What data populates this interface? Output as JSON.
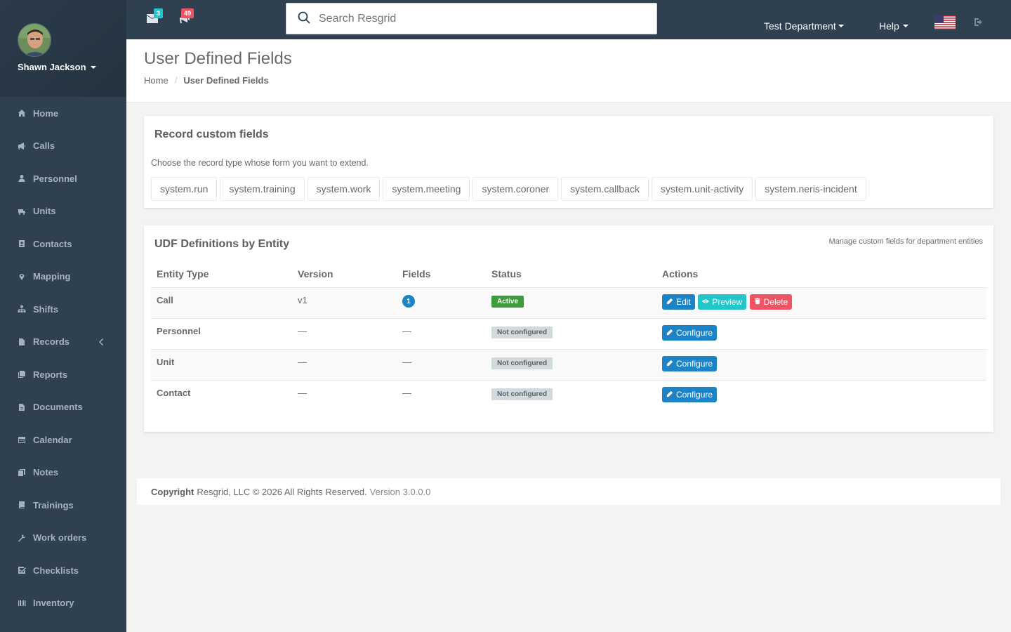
{
  "user": {
    "name": "Shawn Jackson"
  },
  "sidebar": {
    "items": [
      {
        "label": "Home",
        "icon": "home-icon"
      },
      {
        "label": "Calls",
        "icon": "bullhorn-icon"
      },
      {
        "label": "Personnel",
        "icon": "user-icon"
      },
      {
        "label": "Units",
        "icon": "truck-icon"
      },
      {
        "label": "Contacts",
        "icon": "address-book-icon"
      },
      {
        "label": "Mapping",
        "icon": "map-marker-icon"
      },
      {
        "label": "Shifts",
        "icon": "sitemap-icon"
      },
      {
        "label": "Records",
        "icon": "file-icon",
        "has_arrow": true
      },
      {
        "label": "Reports",
        "icon": "reports-icon"
      },
      {
        "label": "Documents",
        "icon": "documents-icon"
      },
      {
        "label": "Calendar",
        "icon": "calendar-icon"
      },
      {
        "label": "Notes",
        "icon": "notes-icon"
      },
      {
        "label": "Trainings",
        "icon": "book-icon"
      },
      {
        "label": "Work orders",
        "icon": "wrench-icon"
      },
      {
        "label": "Checklists",
        "icon": "check-square-icon"
      },
      {
        "label": "Inventory",
        "icon": "barcode-icon"
      }
    ]
  },
  "topbar": {
    "messages_count": "3",
    "calls_count": "49",
    "search_placeholder": "Search Resgrid",
    "department": "Test Department",
    "help": "Help"
  },
  "header": {
    "title": "User Defined Fields",
    "breadcrumb_home": "Home",
    "breadcrumb_current": "User Defined Fields"
  },
  "record_panel": {
    "title": "Record custom fields",
    "help": "Choose the record type whose form you want to extend.",
    "types": [
      "system.run",
      "system.training",
      "system.work",
      "system.meeting",
      "system.coroner",
      "system.callback",
      "system.unit-activity",
      "system.neris-incident"
    ]
  },
  "udf_panel": {
    "title": "UDF Definitions by Entity",
    "subtitle": "Manage custom fields for department entities",
    "columns": [
      "Entity Type",
      "Version",
      "Fields",
      "Status",
      "Actions"
    ],
    "rows": [
      {
        "entity": "Call",
        "version": "v1",
        "fields": "1",
        "status": "Active",
        "actions": [
          "Edit",
          "Preview",
          "Delete"
        ]
      },
      {
        "entity": "Personnel",
        "version": "—",
        "fields": "—",
        "status": "Not configured",
        "actions": [
          "Configure"
        ]
      },
      {
        "entity": "Unit",
        "version": "—",
        "fields": "—",
        "status": "Not configured",
        "actions": [
          "Configure"
        ]
      },
      {
        "entity": "Contact",
        "version": "—",
        "fields": "—",
        "status": "Not configured",
        "actions": [
          "Configure"
        ]
      }
    ]
  },
  "footer": {
    "copyright_label": "Copyright",
    "text": "Resgrid, LLC © 2026 All Rights Reserved.",
    "version": "Version 3.0.0.0"
  },
  "colors": {
    "sidebar_bg": "#2f4050",
    "primary": "#1c84c6",
    "info": "#23c6c8",
    "danger": "#ed5565",
    "active_label": "#3c9c3c",
    "badge_teal": "#23c6c8",
    "badge_red": "#ed5565"
  }
}
